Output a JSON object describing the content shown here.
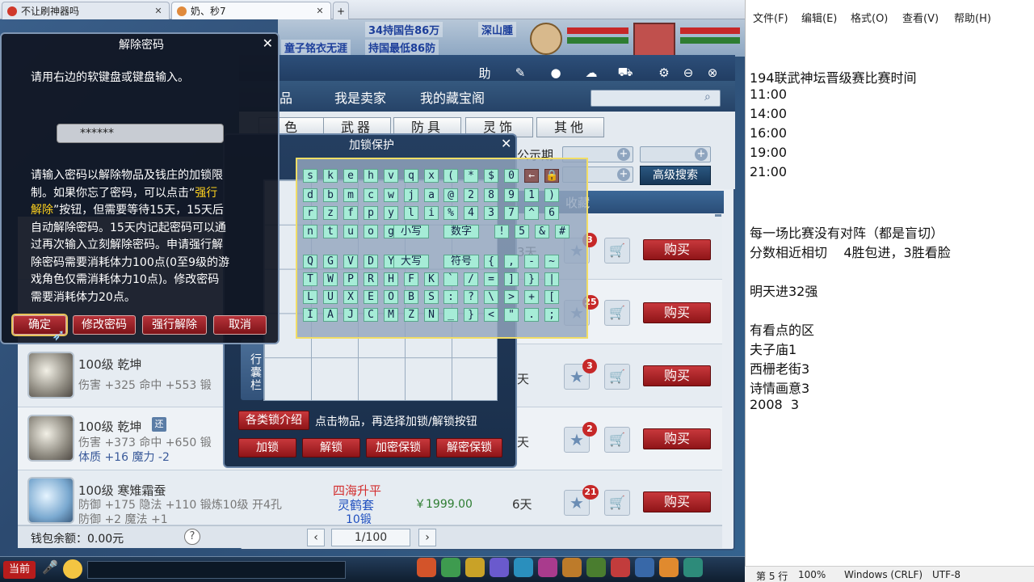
{
  "browser": {
    "tabs": [
      {
        "label": "不让刷神器吗"
      },
      {
        "label": "奶、秒7"
      }
    ]
  },
  "game": {
    "coords": "X:219Y:154",
    "banners": [
      "34持国告86万",
      "童子铭衣无涯",
      "持国最低86防",
      "深山腫"
    ],
    "market": {
      "tabs": [
        "品",
        "我是卖家",
        "我的藏宝阁"
      ],
      "categories": [
        "色",
        "武器",
        "防具",
        "灵饰",
        "其他"
      ],
      "public_label": "公示期",
      "adv_search": "高级搜索",
      "fav_header": "收藏",
      "rows": [
        {
          "days": "3天",
          "badge": "3",
          "buy": "购买"
        },
        {
          "badge": "25",
          "buy": "购买"
        },
        {
          "name": "100级 乾坤",
          "stat": "伤害 +325 命中 +553 锻",
          "days": "天",
          "badge": "3",
          "buy": "购买"
        },
        {
          "name": "100级 乾坤",
          "tag": "还",
          "stat": "伤害 +373 命中 +650 锻",
          "stat2": "体质 +16 魔力 -2",
          "days": "天",
          "badge": "2",
          "buy": "购买"
        },
        {
          "name": "100级 寒雉霜蚕",
          "stat": "防御 +175 隐法 +110 锻炼10级 开4孔",
          "stat3": "防御 +2 魔法 +1",
          "seller1": "四海升平",
          "seller2": "灵鹤套",
          "seller3": "10锻",
          "price": "￥1999.00",
          "days": "6天",
          "badge": "21",
          "buy": "购买"
        }
      ],
      "wallet": "钱包余额：0.00元",
      "help": "?",
      "page": "1/100"
    },
    "lock": {
      "title": "加锁保护",
      "side_label": "行囊栏",
      "intro_btn": "各类锁介绍",
      "hint": "点击物品，再选择加锁/解锁按钮",
      "buttons": [
        "加锁",
        "解锁",
        "加密保锁",
        "解密保锁"
      ]
    },
    "keyboard": {
      "rows": [
        [
          "s",
          "k",
          "e",
          "h",
          "v",
          "q",
          "x",
          "(",
          "*",
          "$",
          "0",
          "←",
          "🔒"
        ],
        [
          "d",
          "b",
          "m",
          "c",
          "w",
          "j",
          "a",
          "@",
          "2",
          "8",
          "9",
          "1",
          ")"
        ],
        [
          "r",
          "z",
          "f",
          "p",
          "y",
          "l",
          "i",
          "%",
          "4",
          "3",
          "7",
          "^",
          "6"
        ],
        [
          "n",
          "t",
          "u",
          "o",
          "g",
          "小写",
          "数字",
          "!",
          "5",
          "&",
          "#"
        ],
        [
          "Q",
          "G",
          "V",
          "D",
          "Y",
          "大写",
          "符号",
          "{",
          ",",
          "-",
          "~"
        ],
        [
          "T",
          "W",
          "P",
          "R",
          "H",
          "F",
          "K",
          "`",
          "/",
          "=",
          "]",
          "}",
          "|"
        ],
        [
          "L",
          "U",
          "X",
          "E",
          "O",
          "B",
          "S",
          ":",
          "?",
          "\\",
          ">",
          "+",
          "["
        ],
        [
          "I",
          "A",
          "J",
          "C",
          "M",
          "Z",
          "N",
          "_",
          "}",
          "<",
          "\"",
          ".",
          ";"
        ]
      ]
    },
    "pwd": {
      "title": "解除密码",
      "prompt": "请用右边的软键盘或键盘输入。",
      "value": "******",
      "desc1": "请输入密码以解除物品及钱庄的加锁限",
      "desc2a": "制。如果你忘了密码，可以点击“",
      "desc2b": "强行",
      "desc3a": "解除",
      "desc3b": "”按钮，但需要等待15天，15天后",
      "desc4": "自动解除密码。15天内记起密码可以通",
      "desc5": "过再次输入立刻解除密码。申请强行解",
      "desc6": "除密码需要消耗体力100点(0至9级的游",
      "desc7": "戏角色仅需消耗体力10点)。修改密码",
      "desc8": "需要消耗体力20点。",
      "buttons": [
        "确定",
        "修改密码",
        "强行解除",
        "取消"
      ]
    },
    "bottom": {
      "label": "当前"
    }
  },
  "notepad": {
    "menu": [
      "文件(F)",
      "编辑(E)",
      "格式(O)",
      "查看(V)",
      "帮助(H)"
    ],
    "lines": [
      "194联武神坛晋级赛比赛时间",
      "11:00",
      "14:00",
      "16:00",
      "19:00",
      "21:00",
      "",
      "",
      "每一场比赛没有对阵（都是盲切）",
      "分数相近相切    4胜包进，3胜看脸",
      "",
      "明天进32强",
      "",
      "有看点的区",
      "夫子庙1",
      "西栅老街3",
      "诗情画意3",
      "2008  3"
    ],
    "status": {
      "pos": "第 5 行",
      "zoom": "100%",
      "eol": "Windows (CRLF)",
      "enc": "UTF-8"
    }
  }
}
